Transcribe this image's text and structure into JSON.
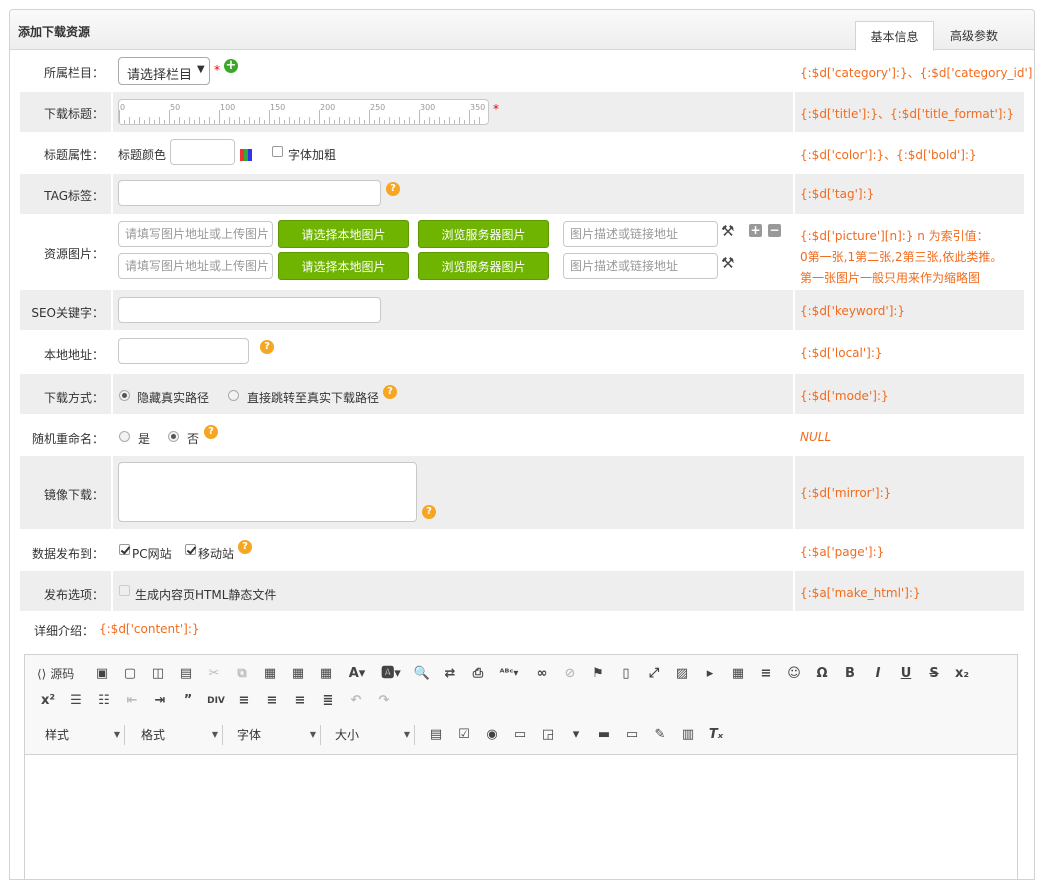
{
  "panel": {
    "title": "添加下载资源"
  },
  "tabs": [
    {
      "label": "基本信息"
    },
    {
      "label": "高级参数"
    }
  ],
  "rows": {
    "category": {
      "label": "所属栏目：",
      "select": "请选择栏目",
      "tpl": "{:$d['category']:}、{:$d['category_id']:}"
    },
    "title": {
      "label": "下载标题：",
      "ruler": [
        "0",
        "50",
        "100",
        "150",
        "200",
        "250",
        "300",
        "350"
      ],
      "tpl": "{:$d['title']:}、{:$d['title_format']:}"
    },
    "attr": {
      "label": "标题属性：",
      "color_label": "标题颜色",
      "bold_label": "字体加粗",
      "tpl": "{:$d['color']:}、{:$d['bold']:}"
    },
    "tag": {
      "label": "TAG标签：",
      "tpl": "{:$d['tag']:}"
    },
    "picture": {
      "label": "资源图片：",
      "url_placeholder": "请填写图片地址或上传图片",
      "local_btn": "请选择本地图片",
      "server_btn": "浏览服务器图片",
      "desc_placeholder": "图片描述或链接地址",
      "tpl_lines": [
        "{:$d['picture'][n]:} n 为索引值：",
        "0第一张,1第二张,2第三张,依此类推。",
        "第一张图片一般只用来作为缩略图"
      ]
    },
    "seo": {
      "label": "SEO关键字：",
      "tpl": "{:$d['keyword']:}"
    },
    "local": {
      "label": "本地地址：",
      "tpl": "{:$d['local']:}"
    },
    "mode": {
      "label": "下载方式：",
      "opt1": "隐藏真实路径",
      "opt2": "直接跳转至真实下载路径",
      "tpl": "{:$d['mode']:}"
    },
    "rename": {
      "label": "随机重命名：",
      "opt1": "是",
      "opt2": "否",
      "tpl": "NULL"
    },
    "mirror": {
      "label": "镜像下载：",
      "tpl": "{:$d['mirror']:}"
    },
    "publish": {
      "label": "数据发布到：",
      "opt1": "PC网站",
      "opt2": "移动站",
      "tpl": "{:$a['page']:}"
    },
    "release": {
      "label": "发布选项：",
      "opt1": "生成内容页HTML静态文件",
      "tpl": "{:$a['make_html']:}"
    },
    "content": {
      "label": "详细介绍：",
      "tpl": "{:$d['content']:}"
    }
  },
  "editor": {
    "source_label": "源码",
    "combos": [
      {
        "label": "样式"
      },
      {
        "label": "格式"
      },
      {
        "label": "字体"
      },
      {
        "label": "大小"
      }
    ]
  },
  "colors": {
    "accent_green": "#6fb400",
    "template_orange": "#f26b1d",
    "row_gray": "#eeeeee"
  }
}
